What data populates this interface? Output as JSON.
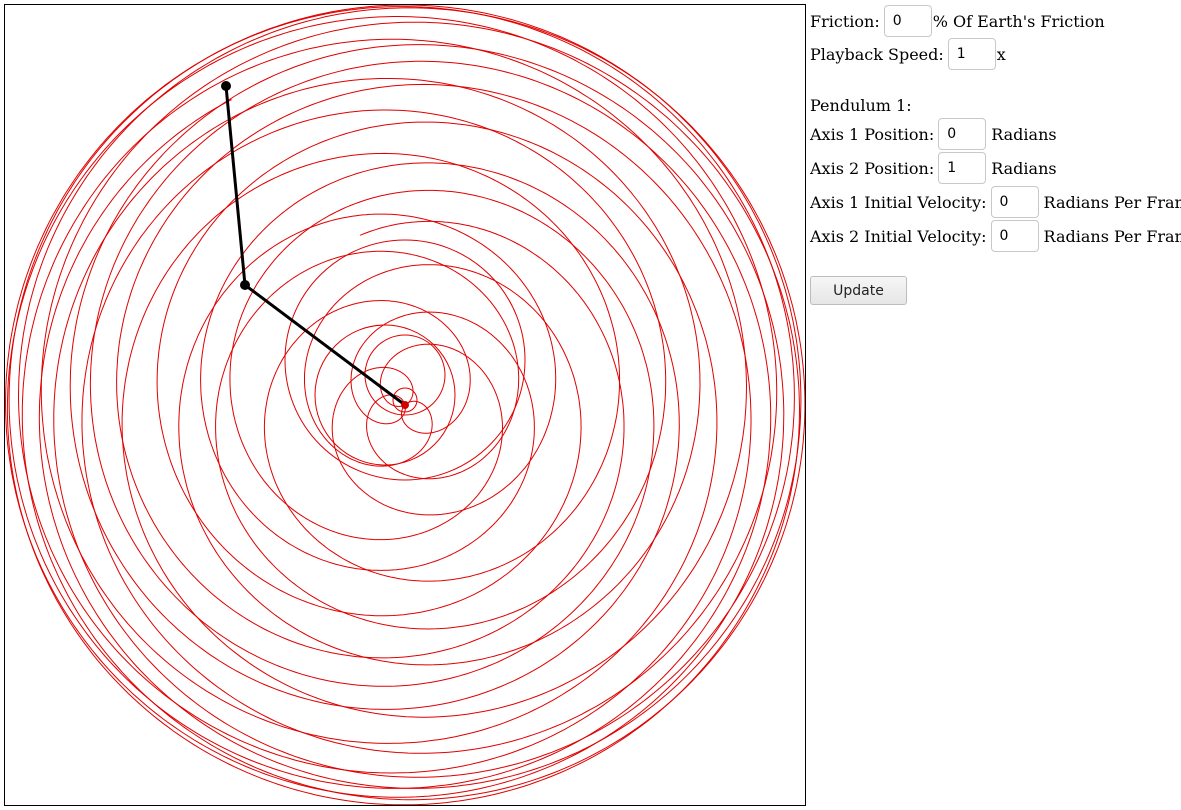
{
  "controls": {
    "friction": {
      "label": "Friction:",
      "value": "0",
      "unit": "% Of Earth's Friction"
    },
    "playback": {
      "label": "Playback Speed:",
      "value": "1",
      "unit": "x"
    },
    "pendulum_header": "Pendulum 1:",
    "axis1_position": {
      "label": "Axis 1 Position:",
      "value": "0",
      "unit": "Radians"
    },
    "axis2_position": {
      "label": "Axis 2 Position:",
      "value": "1",
      "unit": "Radians"
    },
    "axis1_velocity": {
      "label": "Axis 1 Initial Velocity:",
      "value": "0",
      "unit": "Radians Per Frame"
    },
    "axis2_velocity": {
      "label": "Axis 2 Initial Velocity:",
      "value": "0",
      "unit": "Radians Per Frame"
    },
    "update_label": "Update"
  },
  "colors": {
    "trail": "#e00000",
    "rod": "#000000",
    "pivot": "#d00000"
  }
}
